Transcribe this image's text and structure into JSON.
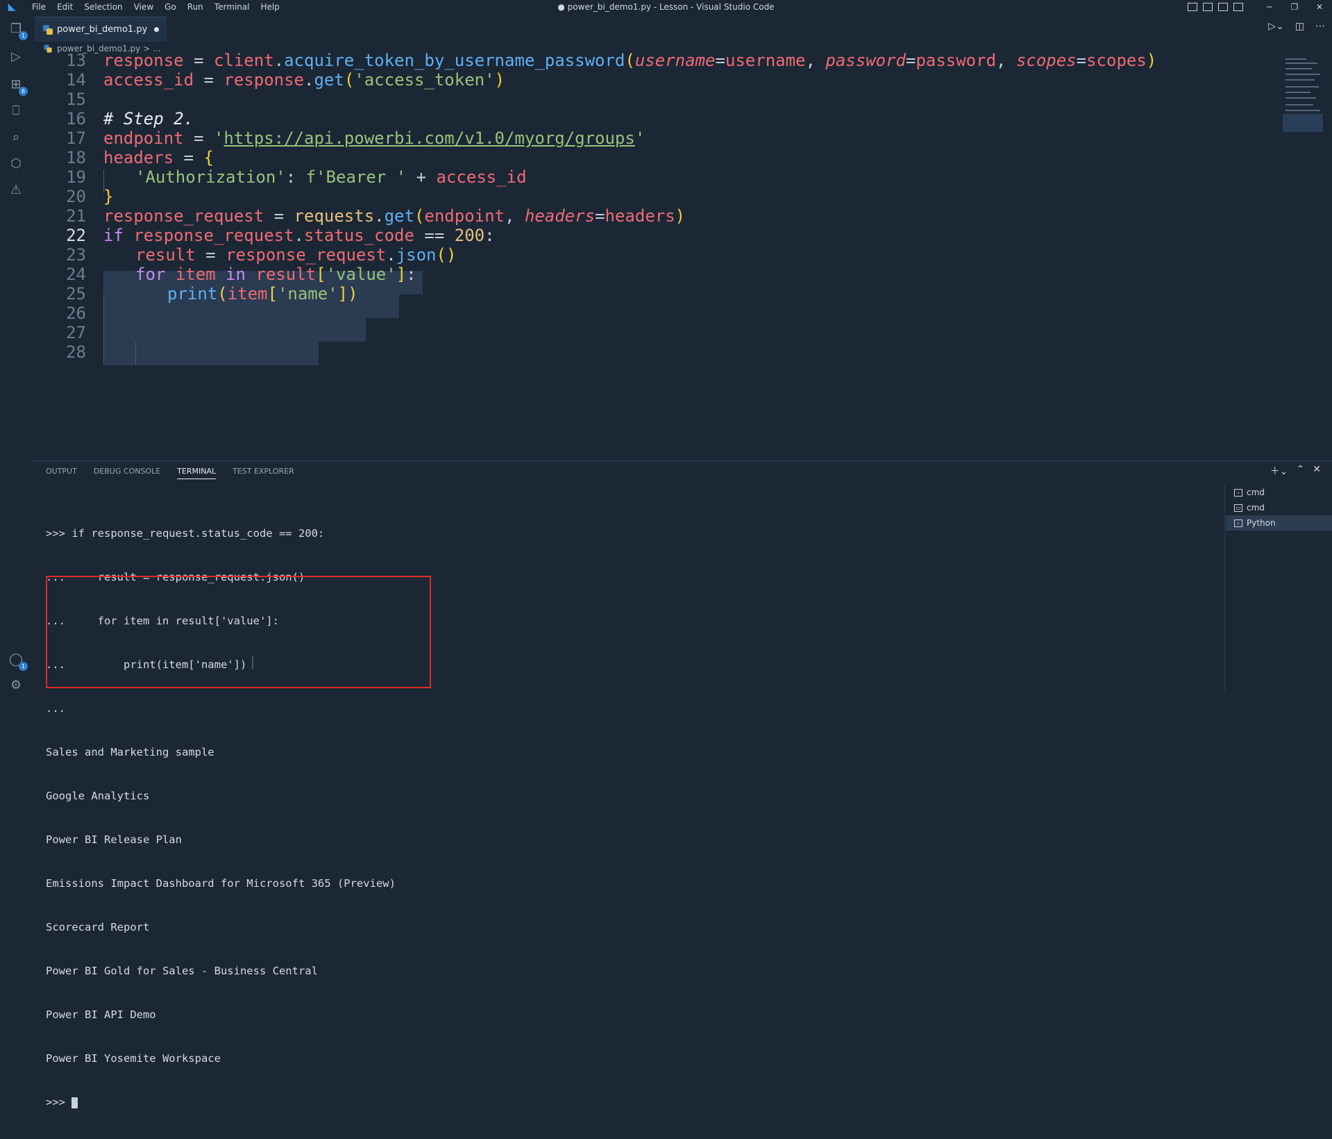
{
  "window": {
    "menu": [
      "File",
      "Edit",
      "Selection",
      "View",
      "Go",
      "Run",
      "Terminal",
      "Help"
    ],
    "title": "● power_bi_demo1.py - Lesson - Visual Studio Code"
  },
  "activity": {
    "explorer_badge": "1",
    "extensions_badge": "6",
    "accounts_badge": "1"
  },
  "tab": {
    "label": "power_bi_demo1.py"
  },
  "breadcrumb": {
    "file": "power_bi_demo1.py",
    "sep": ">",
    "rest": "..."
  },
  "editor": {
    "line_numbers": [
      "13",
      "14",
      "15",
      "16",
      "17",
      "18",
      "19",
      "20",
      "21",
      "22",
      "23",
      "24",
      "25",
      "26",
      "27",
      "28"
    ],
    "current_line": "22",
    "code": {
      "l13": {
        "a": "response",
        "b": " = ",
        "c": "client",
        "d": ".",
        "e": "acquire_token_by_username_password",
        "f": "(",
        "g": "username",
        "h": "=",
        "i": "username",
        "j": ", ",
        "k": "password",
        "l": "=",
        "m": "password",
        "n": ", ",
        "o": "scopes",
        "p": "=",
        "q": "scopes",
        "r": ")"
      },
      "l14": {
        "a": "access_id",
        "b": " = ",
        "c": "response",
        "d": ".",
        "e": "get",
        "f": "(",
        "g": "'access_token'",
        "h": ")"
      },
      "l16": {
        "a": "# Step 2."
      },
      "l17": {
        "a": "endpoint",
        "b": " = ",
        "c": "'",
        "d": "https://api.powerbi.com/v1.0/myorg/groups",
        "e": "'"
      },
      "l18": {
        "a": "headers",
        "b": " = ",
        "c": "{"
      },
      "l19": {
        "a": "'Authorization'",
        "b": ": ",
        "c": "f'Bearer '",
        "d": " + ",
        "e": "access_id"
      },
      "l20": {
        "a": "}"
      },
      "l21": {
        "a": "response_request",
        "b": " = ",
        "c": "requests",
        "d": ".",
        "e": "get",
        "f": "(",
        "g": "endpoint",
        "h": ", ",
        "i": "headers",
        "j": "=",
        "k": "headers",
        "l": ")"
      },
      "l22": {
        "a": "if",
        "b": " ",
        "c": "response_request",
        "d": ".",
        "e": "status_code",
        "f": " == ",
        "g": "200",
        "h": ":"
      },
      "l23": {
        "a": "result",
        "b": " = ",
        "c": "response_request",
        "d": ".",
        "e": "json",
        "f": "()"
      },
      "l24": {
        "a": "for",
        "b": " ",
        "c": "item",
        "d": " in ",
        "e": "result",
        "f": "[",
        "g": "'value'",
        "h": "]",
        "i": ":"
      },
      "l25": {
        "a": "print",
        "b": "(",
        "c": "item",
        "d": "[",
        "e": "'name'",
        "f": "]",
        "g": ")"
      }
    }
  },
  "panel": {
    "tabs": [
      "OUTPUT",
      "DEBUG CONSOLE",
      "TERMINAL",
      "TEST EXPLORER"
    ],
    "active_tab": "TERMINAL",
    "terminal_lines": [
      ">>> if response_request.status_code == 200:",
      "...     result = response_request.json()",
      "...     for item in result['value']:",
      "...         print(item['name'])",
      "...",
      "Sales and Marketing sample",
      "Google Analytics",
      "Power BI Release Plan",
      "Emissions Impact Dashboard for Microsoft 365 (Preview)",
      "Scorecard Report",
      "Power BI Gold for Sales - Business Central",
      "Power BI API Demo",
      "Power BI Yosemite Workspace"
    ],
    "prompt": ">>> ",
    "terminals": [
      "cmd",
      "cmd",
      "Python"
    ],
    "active_terminal": "Python"
  }
}
